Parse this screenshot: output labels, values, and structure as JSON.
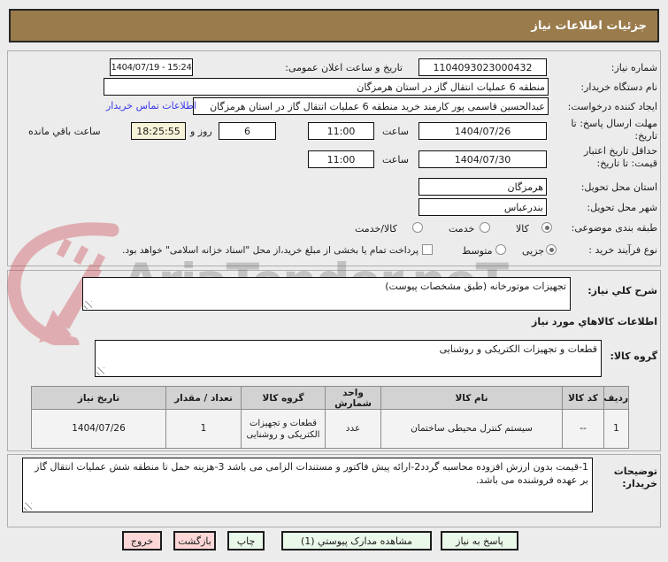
{
  "colors": {
    "title_bar_brown": "#9a7b4b",
    "link_blue": "#3a3aee",
    "remaining_highlight_yellow": "#f7f3d8",
    "button_green": "#eaf8ea",
    "button_pink": "#fdd7d7",
    "table_header_gray": "#d2d2d2",
    "watermark_red": "#c41f2b"
  },
  "title_bar": {
    "title": "جزئیات اطلاعات نیاز"
  },
  "watermark": {
    "text": "AriaTender.neT",
    "logo": "shield-arrow-logo"
  },
  "form": {
    "need_number": {
      "label": "شماره نیاز:",
      "value": "1104093023000432"
    },
    "announce": {
      "label": "تاریخ و ساعت اعلان عمومی:",
      "value": "1404/07/19 - 15:24"
    },
    "buyer_org": {
      "label": "نام دستگاه خریدار:",
      "value": "منطقه 6 عملیات انتقال گاز در استان هرمزگان"
    },
    "requester": {
      "label": "ایجاد کننده درخواست:",
      "value": "عبدالحسین قاسمی پور کارمند خرید منطقه 6 عملیات انتقال گاز در استان هرمزگان",
      "contact_link": "اطلاعات تماس خریدار"
    },
    "deadline": {
      "label": "مهلت ارسال پاسخ: تا تاریخ:",
      "date": "1404/07/26",
      "hour_label": "ساعت",
      "time": "11:00",
      "days_value": "6",
      "days_label": "روز و",
      "remaining_time": "18:25:55",
      "remaining_label": "ساعت باقي مانده"
    },
    "validity": {
      "label": "حداقل تاریخ اعتبار قیمت: تا تاریخ:",
      "date": "1404/07/30",
      "hour_label": "ساعت",
      "time": "11:00"
    },
    "province": {
      "label": "استان محل تحویل:",
      "value": "هرمزگان"
    },
    "city": {
      "label": "شهر محل تحویل:",
      "value": "بندرعباس"
    },
    "category": {
      "label": "طبقه بندی موضوعی:",
      "options": [
        "کالا",
        "خدمت",
        "کالا/خدمت"
      ],
      "selected": "کالا"
    },
    "process": {
      "label": "نوع فرآیند خرید :",
      "options": [
        "جزیی",
        "متوسط"
      ],
      "selected": "جزیی",
      "treasury_note": "پرداخت تمام یا بخشی از مبلغ خرید،از محل \"اسناد خزانه اسلامی\" خواهد بود."
    },
    "need_desc": {
      "label": "شرح کلي نیاز:",
      "value": "تجهیزات موتورخانه (طبق مشخصات پیوست)"
    },
    "goods_section_title": "اطلاعات کالاهاي مورد نیاز",
    "goods_group": {
      "label": "گروه کالا:",
      "value": "قطعات و تجهیزات الکتریکی و روشنایی"
    },
    "buyer_notes": {
      "label": "توضیحات خریدار:",
      "value": "1-قیمت بدون ارزش افزوده محاسبه گردد2-ارائه پیش فاکتور و مستندات الزامی می باشد 3-هزینه حمل تا منطقه شش عملیات انتقال گاز بر عهده فروشنده می باشد."
    }
  },
  "table": {
    "headers": [
      "ردیف",
      "کد کالا",
      "نام کالا",
      "واحد شمارش",
      "گروه کالا",
      "تعداد / مقدار",
      "تاریخ نیاز"
    ],
    "rows": [
      [
        "1",
        "--",
        "سیستم کنترل محیطی ساختمان",
        "عدد",
        "قطعات و تجهیزات الکتریکی و روشنایی",
        "1",
        "1404/07/26"
      ]
    ]
  },
  "footer_buttons": [
    {
      "label": "پاسخ به نیاز",
      "style": "green"
    },
    {
      "label": "مشاهده مدارک پیوستي (1)",
      "style": "green"
    },
    {
      "label": "چاپ",
      "style": "green"
    },
    {
      "label": "بازگشت",
      "style": "pink"
    },
    {
      "label": "خروج",
      "style": "pink"
    }
  ]
}
